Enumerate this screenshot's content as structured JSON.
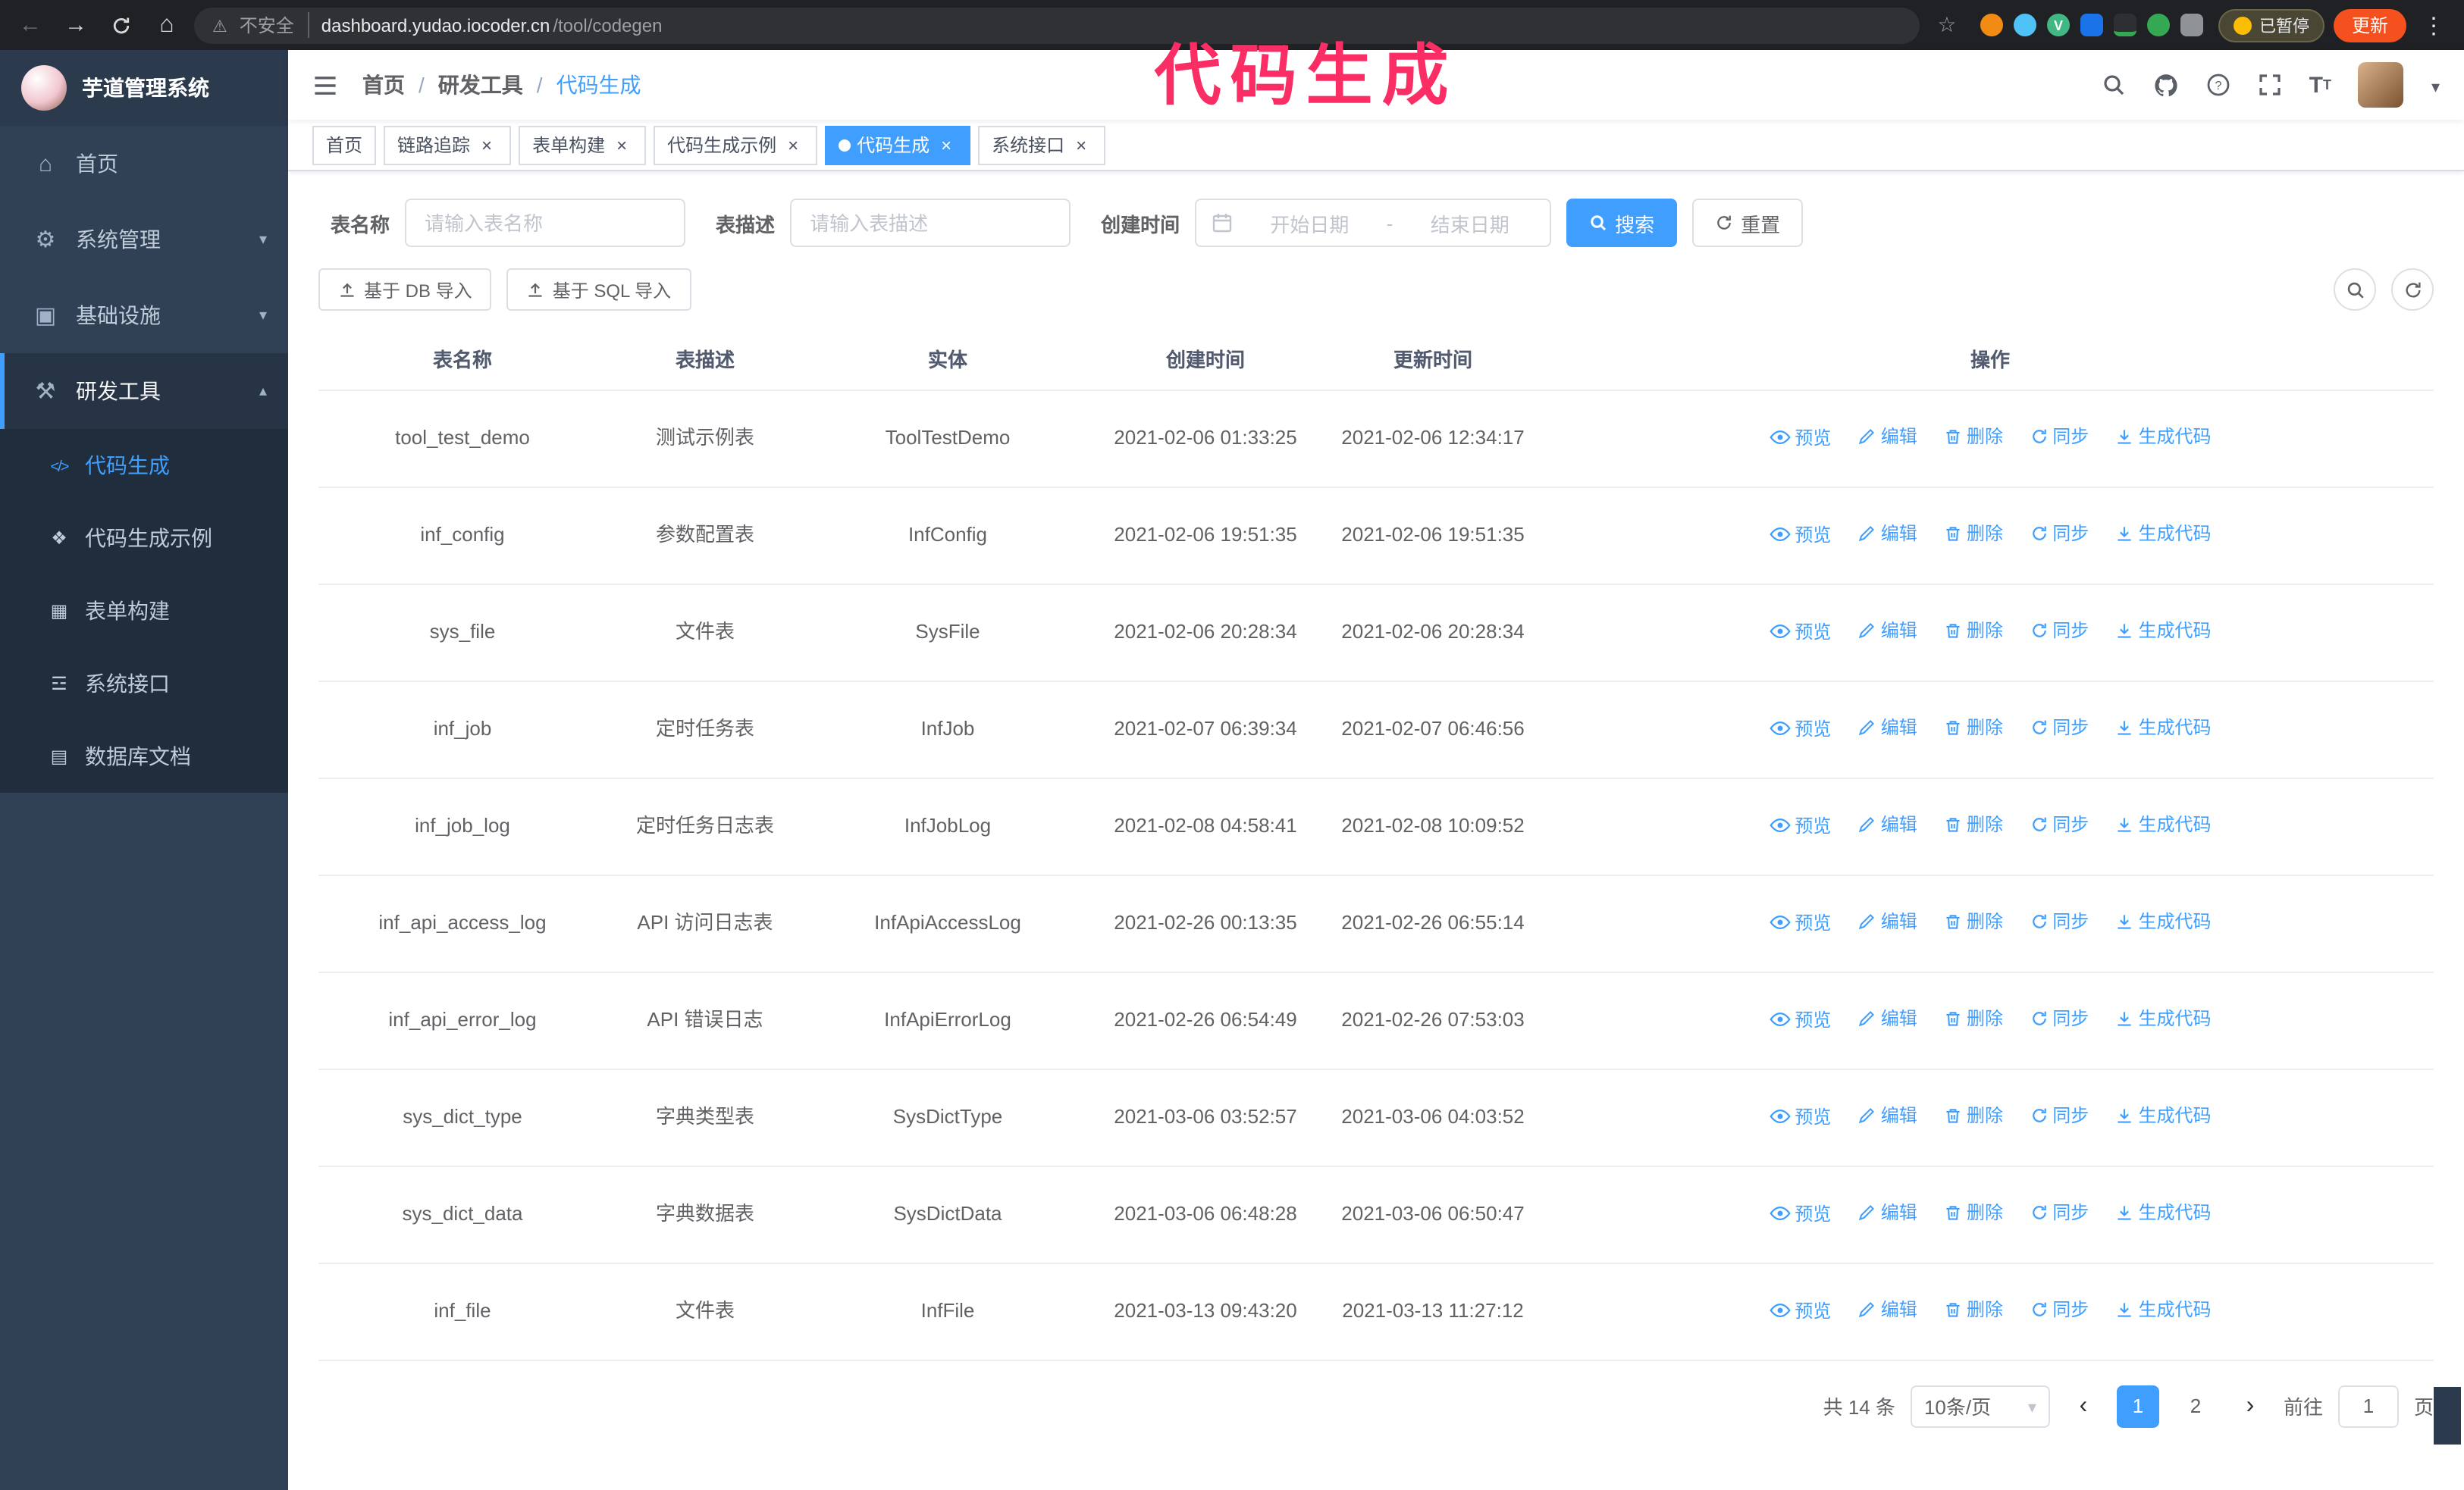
{
  "browser": {
    "security_label": "不安全",
    "url_domain": "dashboard.yudao.iocoder.cn",
    "url_path": "/tool/codegen",
    "paused_badge": "已暂停",
    "update_button": "更新"
  },
  "annotation": "代码生成",
  "sidebar": {
    "logo_title": "芋道管理系统",
    "items": [
      {
        "label": "首页",
        "icon": "home",
        "expandable": false
      },
      {
        "label": "系统管理",
        "icon": "gear",
        "expandable": true
      },
      {
        "label": "基础设施",
        "icon": "infra",
        "expandable": true
      },
      {
        "label": "研发工具",
        "icon": "tools",
        "expandable": true,
        "expanded": true
      }
    ],
    "submenu": [
      {
        "label": "代码生成",
        "icon": "code",
        "active": true
      },
      {
        "label": "代码生成示例",
        "icon": "example",
        "active": false
      },
      {
        "label": "表单构建",
        "icon": "form",
        "active": false
      },
      {
        "label": "系统接口",
        "icon": "api",
        "active": false
      },
      {
        "label": "数据库文档",
        "icon": "db",
        "active": false
      }
    ]
  },
  "header": {
    "breadcrumb": [
      {
        "label": "首页"
      },
      {
        "label": "研发工具"
      },
      {
        "label": "代码生成"
      }
    ]
  },
  "tabs": [
    {
      "label": "首页",
      "closable": false,
      "active": false
    },
    {
      "label": "链路追踪",
      "closable": true,
      "active": false
    },
    {
      "label": "表单构建",
      "closable": true,
      "active": false
    },
    {
      "label": "代码生成示例",
      "closable": true,
      "active": false
    },
    {
      "label": "代码生成",
      "closable": true,
      "active": true
    },
    {
      "label": "系统接口",
      "closable": true,
      "active": false
    }
  ],
  "filters": {
    "table_name_label": "表名称",
    "table_name_placeholder": "请输入表名称",
    "table_desc_label": "表描述",
    "table_desc_placeholder": "请输入表描述",
    "create_time_label": "创建时间",
    "date_start_placeholder": "开始日期",
    "date_separator": "-",
    "date_end_placeholder": "结束日期",
    "search_button": "搜索",
    "reset_button": "重置"
  },
  "toolbar": {
    "import_db": "基于 DB 导入",
    "import_sql": "基于 SQL 导入"
  },
  "table": {
    "columns": [
      "表名称",
      "表描述",
      "实体",
      "创建时间",
      "更新时间",
      "操作"
    ],
    "actions": [
      "预览",
      "编辑",
      "删除",
      "同步",
      "生成代码"
    ],
    "rows": [
      {
        "name": "tool_test_demo",
        "desc": "测试示例表",
        "entity": "ToolTestDemo",
        "created": "2021-02-06 01:33:25",
        "updated": "2021-02-06 12:34:17"
      },
      {
        "name": "inf_config",
        "desc": "参数配置表",
        "entity": "InfConfig",
        "created": "2021-02-06 19:51:35",
        "updated": "2021-02-06 19:51:35"
      },
      {
        "name": "sys_file",
        "desc": "文件表",
        "entity": "SysFile",
        "created": "2021-02-06 20:28:34",
        "updated": "2021-02-06 20:28:34"
      },
      {
        "name": "inf_job",
        "desc": "定时任务表",
        "entity": "InfJob",
        "created": "2021-02-07 06:39:34",
        "updated": "2021-02-07 06:46:56"
      },
      {
        "name": "inf_job_log",
        "desc": "定时任务日志表",
        "entity": "InfJobLog",
        "created": "2021-02-08 04:58:41",
        "updated": "2021-02-08 10:09:52"
      },
      {
        "name": "inf_api_access_log",
        "desc": "API 访问日志表",
        "entity": "InfApiAccessLog",
        "created": "2021-02-26 00:13:35",
        "updated": "2021-02-26 06:55:14"
      },
      {
        "name": "inf_api_error_log",
        "desc": "API 错误日志",
        "entity": "InfApiErrorLog",
        "created": "2021-02-26 06:54:49",
        "updated": "2021-02-26 07:53:03"
      },
      {
        "name": "sys_dict_type",
        "desc": "字典类型表",
        "entity": "SysDictType",
        "created": "2021-03-06 03:52:57",
        "updated": "2021-03-06 04:03:52"
      },
      {
        "name": "sys_dict_data",
        "desc": "字典数据表",
        "entity": "SysDictData",
        "created": "2021-03-06 06:48:28",
        "updated": "2021-03-06 06:50:47"
      },
      {
        "name": "inf_file",
        "desc": "文件表",
        "entity": "InfFile",
        "created": "2021-03-13 09:43:20",
        "updated": "2021-03-13 11:27:12"
      }
    ]
  },
  "pagination": {
    "total": "共 14 条",
    "page_size": "10条/页",
    "pages": [
      {
        "label": "1",
        "active": true
      },
      {
        "label": "2",
        "active": false
      }
    ],
    "goto_label": "前往",
    "goto_value": "1",
    "goto_suffix": "页"
  },
  "colors": {
    "accent": "#409EFF",
    "annotation": "#FA2E64",
    "sidebar_bg": "#304156",
    "submenu_bg": "#1F2D3D"
  }
}
